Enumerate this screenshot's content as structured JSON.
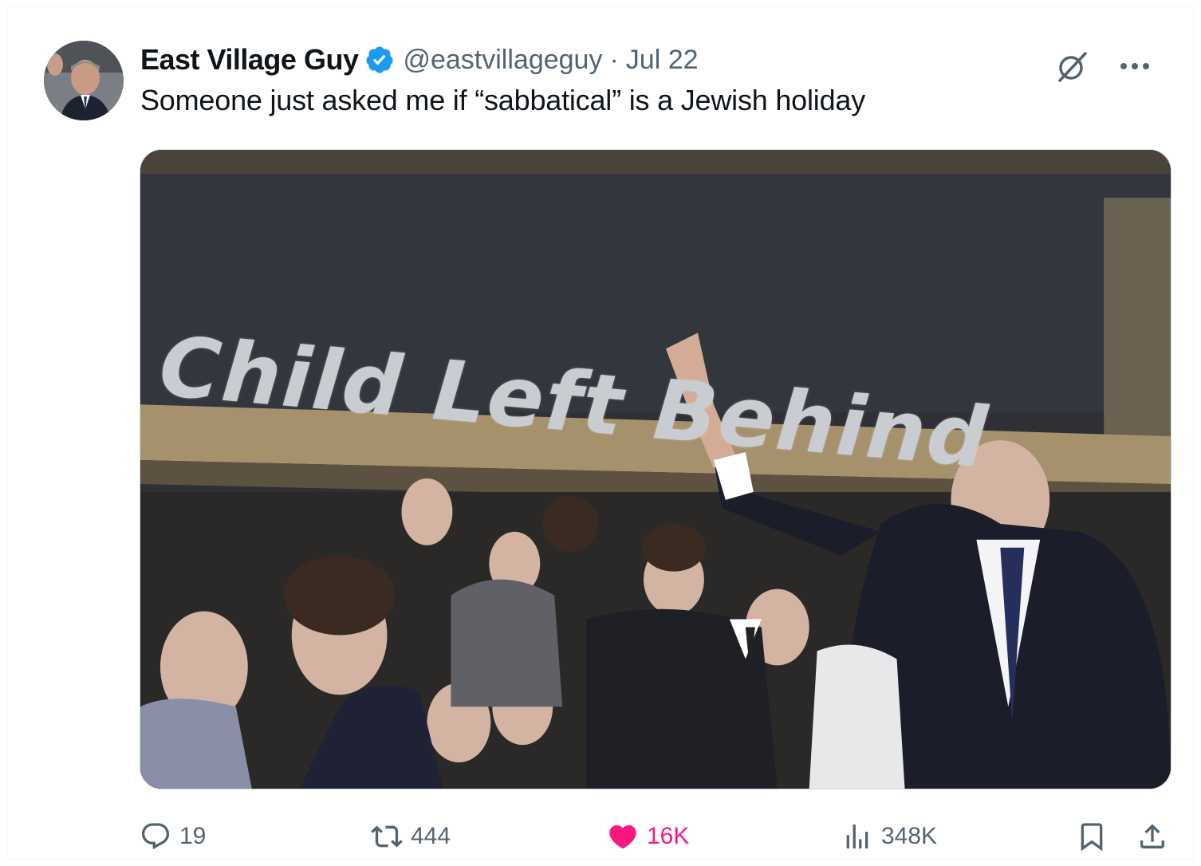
{
  "author": {
    "display_name": "East Village Guy",
    "handle": "@eastvillageguy",
    "separator": "·",
    "date": "Jul 22",
    "verified": true,
    "verified_color": "#1d9bf0"
  },
  "tweet": {
    "text": "Someone just asked me if “sabbatical” is a Jewish holiday"
  },
  "media": {
    "board_text": "Child Left Behind"
  },
  "actions": {
    "replies": "19",
    "reposts": "444",
    "likes": "16K",
    "views": "348K",
    "liked": true,
    "like_color": "#f91880"
  },
  "icons": {
    "top": [
      "grok-icon",
      "more-icon"
    ],
    "bottom": [
      "reply-icon",
      "repost-icon",
      "heart-icon",
      "views-icon",
      "bookmark-icon",
      "share-icon"
    ]
  }
}
